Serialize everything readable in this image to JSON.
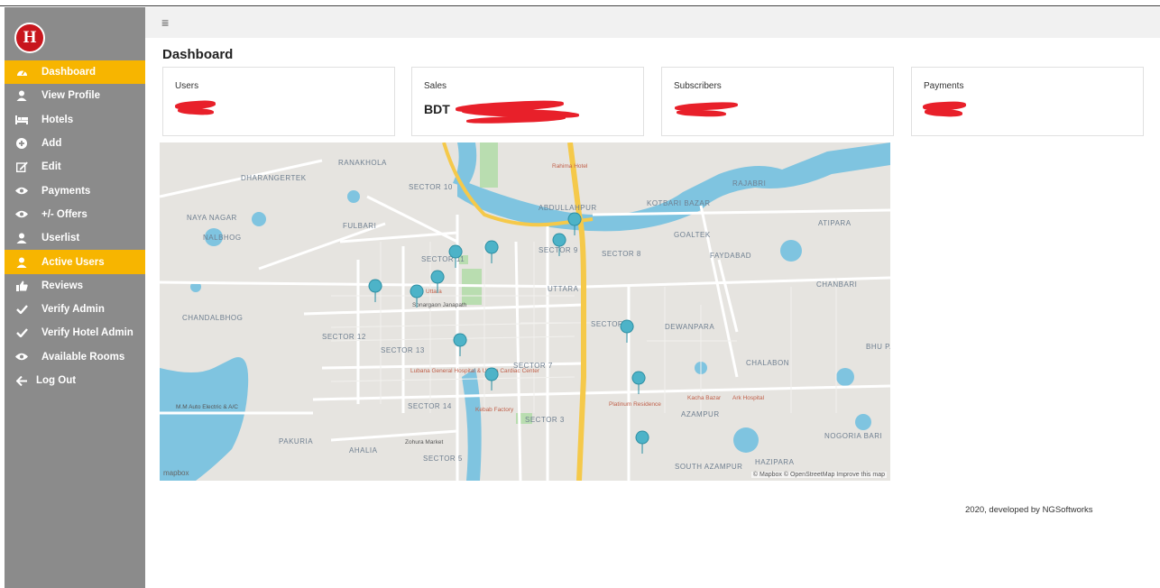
{
  "app": {
    "logo_letter": "H"
  },
  "topbar": {
    "menu_icon": "hamburger-icon"
  },
  "page": {
    "title": "Dashboard"
  },
  "nav": [
    {
      "label": "Dashboard",
      "icon": "dashboard-icon",
      "active": true
    },
    {
      "label": "View Profile",
      "icon": "user-icon",
      "active": false
    },
    {
      "label": "Hotels",
      "icon": "bed-icon",
      "active": false
    },
    {
      "label": "Add",
      "icon": "plus-circle-icon",
      "active": false
    },
    {
      "label": "Edit",
      "icon": "edit-icon",
      "active": false
    },
    {
      "label": "Payments",
      "icon": "eye-icon",
      "active": false
    },
    {
      "label": "+/- Offers",
      "icon": "eye-icon",
      "active": false
    },
    {
      "label": "Userlist",
      "icon": "user-icon",
      "active": false
    },
    {
      "label": "Active Users",
      "icon": "user-icon",
      "active": true
    },
    {
      "label": "Reviews",
      "icon": "thumbs-up-icon",
      "active": false
    },
    {
      "label": "Verify Admin",
      "icon": "check-icon",
      "active": false
    },
    {
      "label": "Verify Hotel Admin",
      "icon": "check-icon",
      "active": false
    },
    {
      "label": "Available Rooms",
      "icon": "eye-icon",
      "active": false
    },
    {
      "label": "Log Out",
      "icon": "arrow-left-icon",
      "active": false
    }
  ],
  "cards": [
    {
      "label": "Users",
      "value": ""
    },
    {
      "label": "Sales",
      "value": "BDT"
    },
    {
      "label": "Subscribers",
      "value": ""
    },
    {
      "label": "Payments",
      "value": ""
    }
  ],
  "map": {
    "labels": [
      "DHARANGERTEK",
      "RANAKHOLA",
      "SECTOR 10",
      "NAYA NAGAR",
      "FULBARI",
      "NALBHOG",
      "SECTOR 11",
      "SECTOR 9",
      "SECTOR 8",
      "UTTARA",
      "CHANDALBHOG",
      "SECTOR 12",
      "SECTOR 13",
      "SECTOR 6",
      "SECTOR 7",
      "DEWANPARA",
      "SECTOR 14",
      "SECTOR 3",
      "SECTOR 5",
      "PAKURIA",
      "AHALIA",
      "AZAMPUR",
      "SOUTH AZAMPUR",
      "KOTBARI BAZAR",
      "ABDULLAHPUR",
      "RAJABRI",
      "ATIPARA",
      "GOALTEK",
      "FAYDABAD",
      "CHANBARI",
      "CHALABON",
      "NOGORIA BARI",
      "HAZIPARA",
      "BHU PA",
      "Rahima Hotel",
      "Lubana General Hospital & Uttara Cardiac Center",
      "Kebab Factory",
      "Platinum Residence",
      "Ark Hospital",
      "Kacha Bazar",
      "Uttara",
      "Sonargaon Janapath",
      "M.M Auto Electric & A/C",
      "Zohura Market"
    ],
    "attribution": "© Mapbox © OpenStreetMap Improve this map",
    "logo": "mapbox"
  },
  "footer": {
    "text": "2020, developed by NGSoftworks"
  }
}
